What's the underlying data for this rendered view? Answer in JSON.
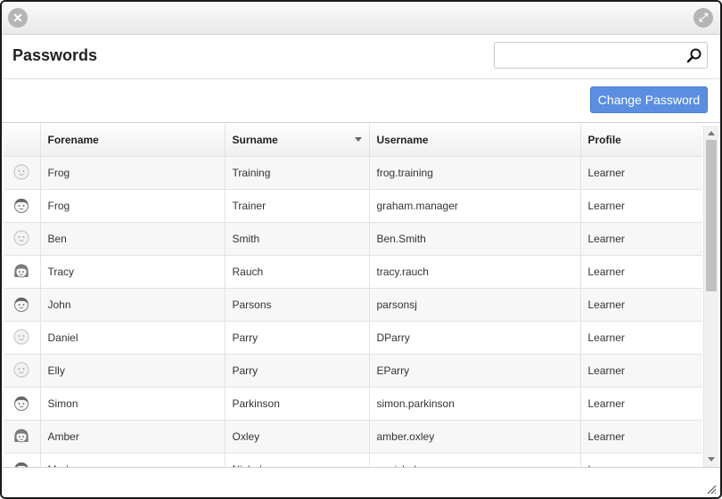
{
  "window": {
    "close_icon": "close-icon",
    "maximize_icon": "expand-icon"
  },
  "header": {
    "title": "Passwords",
    "search": {
      "value": "",
      "placeholder": "",
      "icon": "search-icon"
    }
  },
  "actions": {
    "change_password_label": "Change Password",
    "accent": "#5b8ee0"
  },
  "table": {
    "columns": [
      {
        "key": "avatar",
        "label": ""
      },
      {
        "key": "forename",
        "label": "Forename"
      },
      {
        "key": "surname",
        "label": "Surname",
        "sorted": "desc"
      },
      {
        "key": "username",
        "label": "Username"
      },
      {
        "key": "profile",
        "label": "Profile"
      }
    ],
    "rows": [
      {
        "avatar": "face-plain",
        "forename": "Frog",
        "surname": "Training",
        "username": "frog.training",
        "profile": "Learner"
      },
      {
        "avatar": "face-hair",
        "forename": "Frog",
        "surname": "Trainer",
        "username": "graham.manager",
        "profile": "Learner"
      },
      {
        "avatar": "face-plain",
        "forename": "Ben",
        "surname": "Smith",
        "username": "Ben.Smith",
        "profile": "Learner"
      },
      {
        "avatar": "face-female",
        "forename": "Tracy",
        "surname": "Rauch",
        "username": "tracy.rauch",
        "profile": "Learner"
      },
      {
        "avatar": "face-hair",
        "forename": "John",
        "surname": "Parsons",
        "username": "parsonsj",
        "profile": "Learner"
      },
      {
        "avatar": "face-plain",
        "forename": "Daniel",
        "surname": "Parry",
        "username": "DParry",
        "profile": "Learner"
      },
      {
        "avatar": "face-plain",
        "forename": "Elly",
        "surname": "Parry",
        "username": "EParry",
        "profile": "Learner"
      },
      {
        "avatar": "face-hair",
        "forename": "Simon",
        "surname": "Parkinson",
        "username": "simon.parkinson",
        "profile": "Learner"
      },
      {
        "avatar": "face-female",
        "forename": "Amber",
        "surname": "Oxley",
        "username": "amber.oxley",
        "profile": "Learner"
      },
      {
        "avatar": "face-hair",
        "forename": "Mark",
        "surname": "Nicholson",
        "username": "m.nicholson",
        "profile": "Learner"
      }
    ]
  }
}
